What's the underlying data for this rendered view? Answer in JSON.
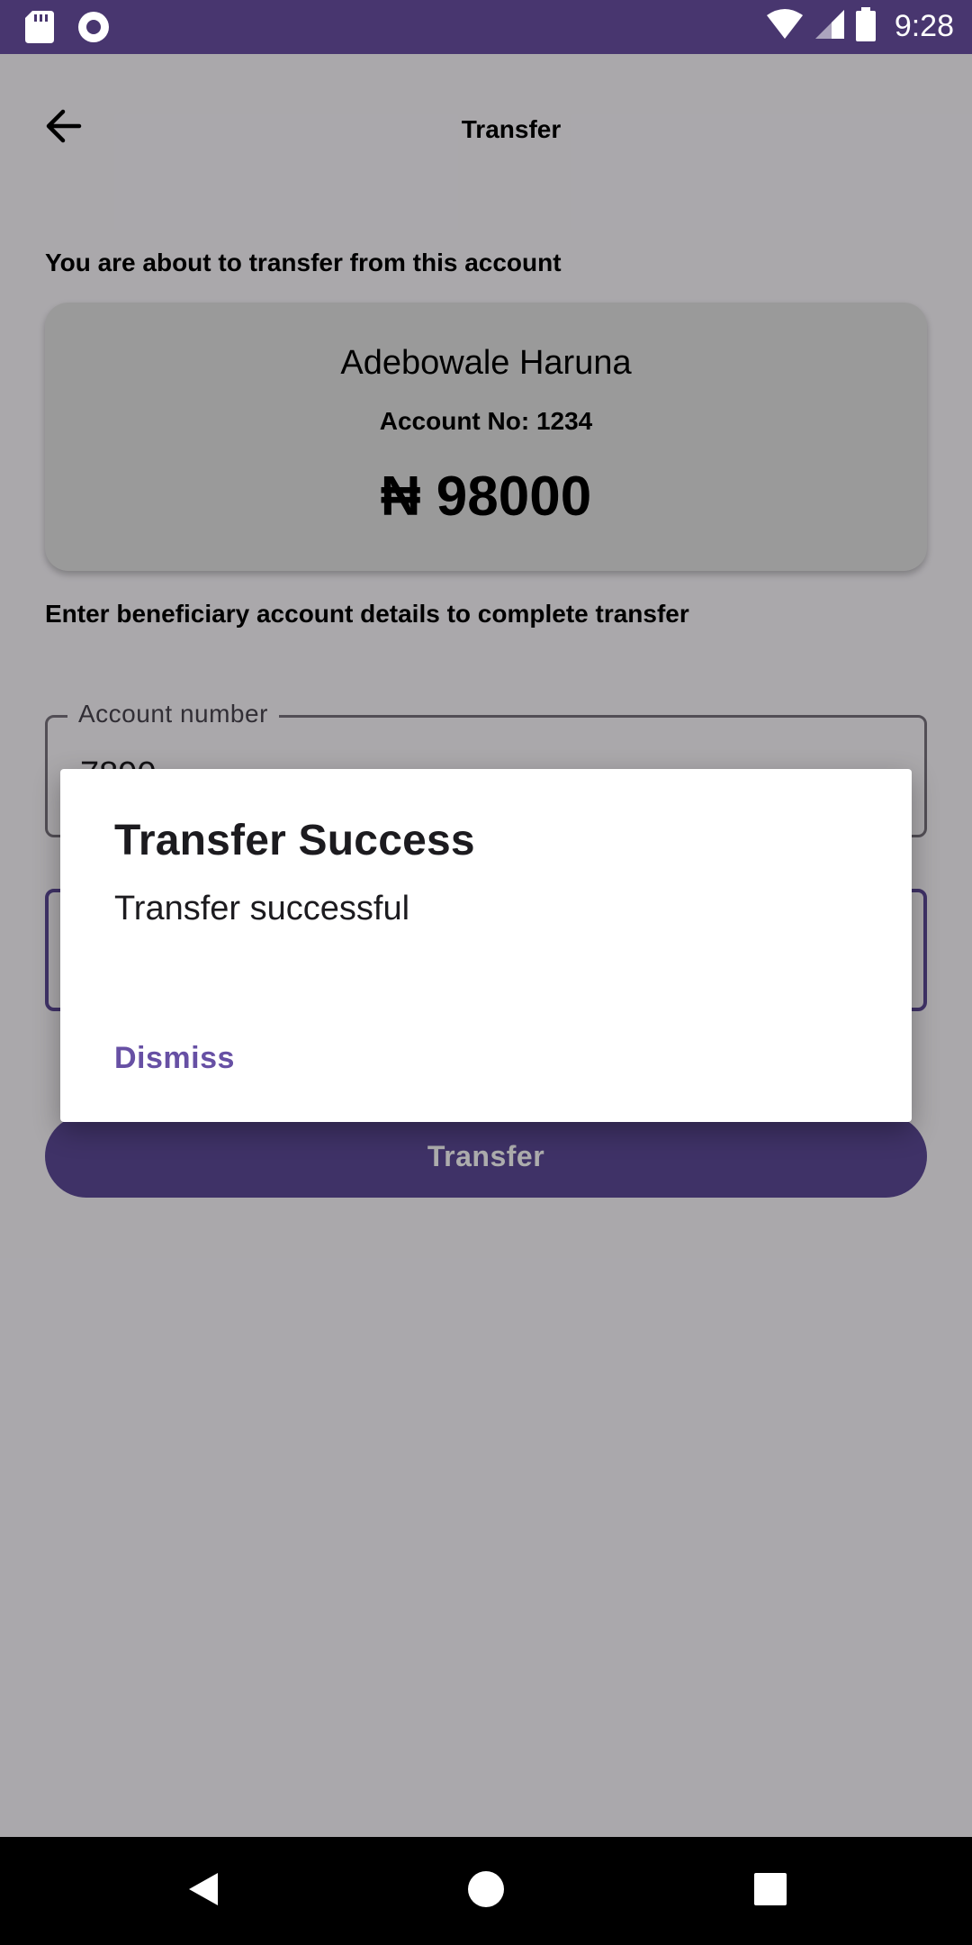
{
  "status_bar": {
    "time": "9:28",
    "background_color": "#48366f",
    "icons": [
      "sd-card-icon",
      "record-icon",
      "wifi-icon",
      "signal-icon",
      "battery-icon"
    ]
  },
  "top_bar": {
    "title": "Transfer",
    "back_icon": "arrow-left-icon"
  },
  "source_section": {
    "label": "You are about to transfer from this account",
    "account_name": "Adebowale Haruna",
    "account_number": "Account No: 1234",
    "balance": "₦ 98000"
  },
  "beneficiary_section": {
    "label": "Enter beneficiary account details to complete transfer",
    "account_number_field": {
      "label": "Account number",
      "value": "7890"
    },
    "amount_field": {
      "value": ""
    }
  },
  "transfer_button": {
    "label": "Transfer",
    "color": "#5e4a99"
  },
  "dialog": {
    "title": "Transfer Success",
    "message": "Transfer successful",
    "dismiss_label": "Dismiss",
    "accent_color": "#6750a4"
  },
  "nav_bar": {
    "icons": [
      "back-triangle-icon",
      "home-circle-icon",
      "recents-square-icon"
    ]
  }
}
